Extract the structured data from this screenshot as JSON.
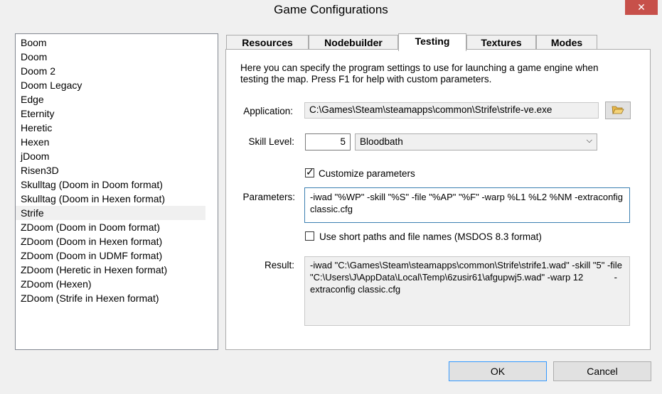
{
  "window": {
    "title": "Game Configurations",
    "close_glyph": "✕"
  },
  "configurations": [
    "Boom",
    "Doom",
    "Doom 2",
    "Doom Legacy",
    "Edge",
    "Eternity",
    "Heretic",
    "Hexen",
    "jDoom",
    "Risen3D",
    "Skulltag (Doom in Doom format)",
    "Skulltag (Doom in Hexen format)",
    "Strife",
    "ZDoom (Doom in Doom format)",
    "ZDoom (Doom in Hexen format)",
    "ZDoom (Doom in UDMF format)",
    "ZDoom (Heretic in Hexen format)",
    "ZDoom (Hexen)",
    "ZDoom (Strife in Hexen format)"
  ],
  "selected_configuration": "Strife",
  "tabs": [
    "Resources",
    "Nodebuilder",
    "Testing",
    "Textures",
    "Modes"
  ],
  "active_tab": "Testing",
  "testing": {
    "description": "Here you can specify the program settings to use for launching a game engine when testing the map. Press F1 for help with custom parameters.",
    "application_label": "Application:",
    "application_value": "C:\\Games\\Steam\\steamapps\\common\\Strife\\strife-ve.exe",
    "browse_icon": "folder-open-icon",
    "skill_label": "Skill Level:",
    "skill_number": "5",
    "skill_name": "Bloodbath",
    "customize_label": "Customize parameters",
    "customize_checked": true,
    "parameters_label": "Parameters:",
    "parameters_value": "-iwad \"%WP\" -skill \"%S\" -file \"%AP\" \"%F\" -warp %L1 %L2 %NM -extraconfig classic.cfg",
    "shortpaths_label": "Use short paths and file names (MSDOS 8.3 format)",
    "shortpaths_checked": false,
    "result_label": "Result:",
    "result_value": "-iwad \"C:\\Games\\Steam\\steamapps\\common\\Strife\\strife1.wad\" -skill \"5\" -file  \"C:\\Users\\J\\AppData\\Local\\Temp\\6zusir61\\afgupwj5.wad\" -warp 12            -extraconfig classic.cfg"
  },
  "buttons": {
    "ok": "OK",
    "cancel": "Cancel"
  },
  "colors": {
    "close_button": "#c7504a",
    "focus_border": "#3c7fb1"
  }
}
